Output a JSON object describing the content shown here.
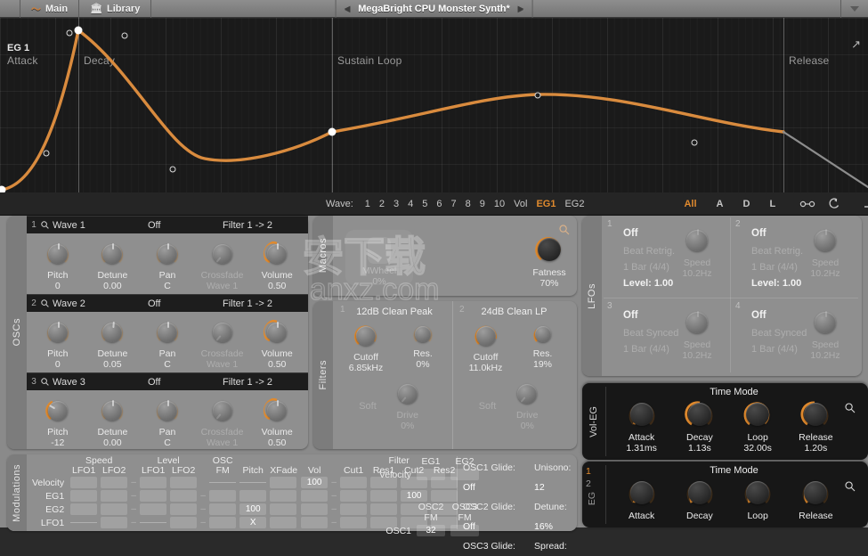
{
  "titlebar": {
    "main_label": "Main",
    "library_label": "Library",
    "preset_name": "MegaBright CPU Monster Synth*",
    "prev_icon": "◀",
    "next_icon": "▶",
    "wave_icon": "〜",
    "library_icon": "🏛",
    "menu_icon": "caret-down-icon"
  },
  "envelope": {
    "title": "EG 1",
    "stages": [
      "Attack",
      "Decay",
      "Sustain Loop",
      "Release"
    ],
    "expand_icon": "↗"
  },
  "toolbar": {
    "wave_label": "Wave:",
    "wave_numbers": [
      "1",
      "2",
      "3",
      "4",
      "5",
      "6",
      "7",
      "8",
      "9",
      "10"
    ],
    "wave_extra": [
      "Vol",
      "EG1",
      "EG2"
    ],
    "selected_wave": "EG1",
    "modes": [
      "All",
      "A",
      "D",
      "L"
    ],
    "selected_mode": "All",
    "icon_link": "link-icon",
    "icon_loop": "loop-icon",
    "shape_flat": "flat-curve-icon",
    "shape_linear": "linear-curve-icon",
    "shape_curve": "exp-curve-icon",
    "shape_random": "random-curve-icon"
  },
  "oscs": {
    "rail_label": "OSCs",
    "rows": [
      {
        "num": "1",
        "wave": "Wave 1",
        "mode": "Off",
        "route": "Filter 1 -> 2",
        "knobs": [
          {
            "label": "Pitch",
            "value": "0",
            "amount": 0.5,
            "dim": false
          },
          {
            "label": "Detune",
            "value": "0.00",
            "amount": 0.5,
            "dim": false
          },
          {
            "label": "Pan",
            "value": "C",
            "amount": 0.5,
            "dim": false
          },
          {
            "label": "Crossfade",
            "value": "Wave 1",
            "amount": 0.0,
            "dim": true
          },
          {
            "label": "Volume",
            "value": "0.50",
            "amount": 0.5,
            "dim": false
          }
        ]
      },
      {
        "num": "2",
        "wave": "Wave 2",
        "mode": "Off",
        "route": "Filter 1 -> 2",
        "knobs": [
          {
            "label": "Pitch",
            "value": "0",
            "amount": 0.5,
            "dim": false
          },
          {
            "label": "Detune",
            "value": "0.05",
            "amount": 0.52,
            "dim": false
          },
          {
            "label": "Pan",
            "value": "C",
            "amount": 0.5,
            "dim": false
          },
          {
            "label": "Crossfade",
            "value": "Wave 1",
            "amount": 0.0,
            "dim": true
          },
          {
            "label": "Volume",
            "value": "0.50",
            "amount": 0.5,
            "dim": false
          }
        ]
      },
      {
        "num": "3",
        "wave": "Wave 3",
        "mode": "Off",
        "route": "Filter 1 -> 2",
        "knobs": [
          {
            "label": "Pitch",
            "value": "-12",
            "amount": 0.28,
            "dim": false
          },
          {
            "label": "Detune",
            "value": "0.00",
            "amount": 0.5,
            "dim": false
          },
          {
            "label": "Pan",
            "value": "C",
            "amount": 0.5,
            "dim": false
          },
          {
            "label": "Crossfade",
            "value": "Wave 1",
            "amount": 0.0,
            "dim": true
          },
          {
            "label": "Volume",
            "value": "0.50",
            "amount": 0.5,
            "dim": false
          }
        ]
      }
    ],
    "search_icon": "search-icon"
  },
  "macros": {
    "rail_label": "Macros",
    "items": [
      {
        "label": "MWheel",
        "value": "0%",
        "amount": 0.0,
        "dim": true
      },
      {
        "label": "Fatness",
        "value": "70%",
        "amount": 0.7,
        "dim": false
      }
    ],
    "search_icon": "search-icon"
  },
  "filters": {
    "rail_label": "Filters",
    "units": [
      {
        "num": "1",
        "title": "12dB Clean Peak",
        "cutoff": {
          "label": "Cutoff",
          "value": "6.85kHz",
          "amount": 0.62
        },
        "res": {
          "label": "Res.",
          "value": "0%",
          "amount": 0.0
        },
        "soft": "Soft",
        "drive": {
          "label": "Drive",
          "value": "0%",
          "amount": 0.0
        }
      },
      {
        "num": "2",
        "title": "24dB Clean LP",
        "cutoff": {
          "label": "Cutoff",
          "value": "11.0kHz",
          "amount": 0.72
        },
        "res": {
          "label": "Res.",
          "value": "19%",
          "amount": 0.19
        },
        "soft": "Soft",
        "drive": {
          "label": "Drive",
          "value": "0%",
          "amount": 0.0
        }
      }
    ]
  },
  "lfos": {
    "rail_label": "LFOs",
    "cells": [
      {
        "num": "1",
        "state": "Off",
        "sync": "Beat Retrig.",
        "rate": "1 Bar (4/4)",
        "level_label": "Level:",
        "level_value": "1.00",
        "speed_label": "Speed",
        "speed_value": "10.2Hz"
      },
      {
        "num": "2",
        "state": "Off",
        "sync": "Beat Retrig.",
        "rate": "1 Bar (4/4)",
        "level_label": "Level:",
        "level_value": "1.00",
        "speed_label": "Speed",
        "speed_value": "10.2Hz"
      },
      {
        "num": "3",
        "state": "Off",
        "sync": "Beat Synced",
        "rate": "1 Bar (4/4)",
        "level_label": "",
        "level_value": "",
        "speed_label": "Speed",
        "speed_value": "10.2Hz"
      },
      {
        "num": "4",
        "state": "Off",
        "sync": "Beat Synced",
        "rate": "1 Bar (4/4)",
        "level_label": "",
        "level_value": "",
        "speed_label": "Speed",
        "speed_value": "10.2Hz"
      }
    ]
  },
  "modulations": {
    "rail_label": "Modulations",
    "group_headers": [
      "Speed",
      "Level",
      "OSC",
      "",
      "Filter"
    ],
    "columns": [
      "LFO1",
      "LFO2",
      "LFO1",
      "LFO2",
      "FM",
      "Pitch",
      "XFade",
      "Vol",
      "Cut1",
      "Res1",
      "Cut2",
      "Res2"
    ],
    "rows": [
      {
        "label": "Velocity",
        "cells": [
          "",
          "",
          "",
          "",
          "",
          "",
          "",
          "100",
          "",
          "",
          "",
          ""
        ]
      },
      {
        "label": "EG1",
        "cells": [
          "",
          "",
          "",
          "",
          "",
          "",
          "",
          "",
          "",
          "",
          "100",
          ""
        ]
      },
      {
        "label": "EG2",
        "cells": [
          "",
          "",
          "",
          "",
          "",
          "100",
          "",
          "",
          "",
          "",
          "",
          ""
        ]
      },
      {
        "label": "LFO1",
        "cells": [
          "",
          "",
          "",
          "",
          "",
          "X",
          "",
          "",
          "",
          "",
          "",
          ""
        ]
      }
    ],
    "eg_block": {
      "headers": [
        "EG1",
        "EG2"
      ],
      "row_label": "Velocity",
      "fm_headers": [
        "OSC2",
        "OSC3"
      ],
      "fm_sub": [
        "FM",
        "FM"
      ],
      "fm_row_label": "OSC1",
      "fm_values": [
        "32",
        ""
      ]
    },
    "glide": [
      {
        "label": "OSC1 Glide:",
        "value": "Off"
      },
      {
        "label": "OSC2 Glide:",
        "value": "Off"
      },
      {
        "label": "OSC3 Glide:",
        "value": ""
      }
    ],
    "unison": [
      {
        "label": "Unisono:",
        "value": "12"
      },
      {
        "label": "Detune:",
        "value": "16%"
      },
      {
        "label": "Spread:",
        "value": ""
      }
    ]
  },
  "vol_eg": {
    "rail_label": "Vol-EG",
    "title": "Time Mode",
    "search_icon": "search-icon",
    "knobs": [
      {
        "label": "Attack",
        "value": "1.31ms",
        "amount": 0.06
      },
      {
        "label": "Decay",
        "value": "1.13s",
        "amount": 0.52
      },
      {
        "label": "Loop",
        "value": "32.00s",
        "amount": 0.82
      },
      {
        "label": "Release",
        "value": "1.20s",
        "amount": 0.5
      }
    ]
  },
  "eg_panel": {
    "rail_label": "EG",
    "tabs": [
      "1",
      "2"
    ],
    "selected_tab": "1",
    "title": "Time Mode",
    "search_icon": "search-icon",
    "knobs": [
      {
        "label": "Attack",
        "value": "",
        "amount": 0.08
      },
      {
        "label": "Decay",
        "value": "",
        "amount": 0.2
      },
      {
        "label": "Loop",
        "value": "",
        "amount": 0.18
      },
      {
        "label": "Release",
        "value": "",
        "amount": 0.3
      }
    ]
  },
  "watermark": {
    "line1": "安下载",
    "line2": "anxz.com"
  },
  "colors": {
    "accent": "#e08a2e",
    "panel": "#8f8f8f",
    "dark": "#171717",
    "grid": "#1a1a1a"
  }
}
